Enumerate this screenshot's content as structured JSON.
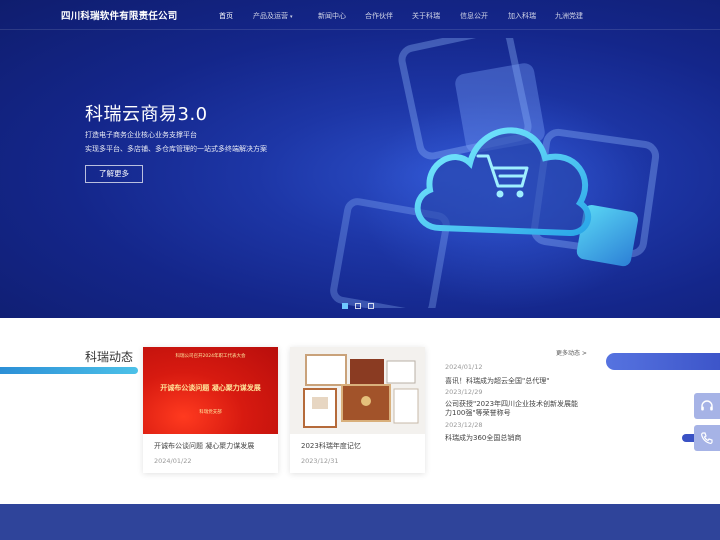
{
  "header": {
    "company": "四川科瑞软件有限责任公司",
    "nav": [
      "首页",
      "产品及运营",
      "新闻中心",
      "合作伙伴",
      "关于科瑞",
      "信息公开",
      "加入科瑞",
      "九洲党建"
    ]
  },
  "hero": {
    "title": "科瑞云商易3.0",
    "line1": "打造电子商务企业核心业务支撑平台",
    "line2": "实现多平台、多店铺、多仓库管理的一站式多终端解决方案",
    "button": "了解更多"
  },
  "news": {
    "section_title": "科瑞动态",
    "more": "更多动态 >",
    "cards": [
      {
        "title": "开诚布公谈问题 凝心聚力谋发展",
        "date": "2024/01/22",
        "image_text": {
          "top": "科瑞公司召开2024年职工代表大会",
          "main": "开诚布公谈问题 凝心聚力谋发展",
          "sub": "科瑞党支部"
        }
      },
      {
        "title": "2023科瑞年度记忆",
        "date": "2023/12/31"
      }
    ],
    "list": [
      {
        "date": "2024/01/12",
        "title": "喜讯！科瑞成为超云全国\"总代理\""
      },
      {
        "date": "2023/12/29",
        "title": "公司获授\"2023年四川企业技术创新发展能力100强\"等荣誉称号"
      },
      {
        "date": "2023/12/28",
        "title": "科瑞成为360全国总销商"
      }
    ]
  },
  "icons": {
    "side1": "headset-icon",
    "side2": "phone-icon"
  }
}
